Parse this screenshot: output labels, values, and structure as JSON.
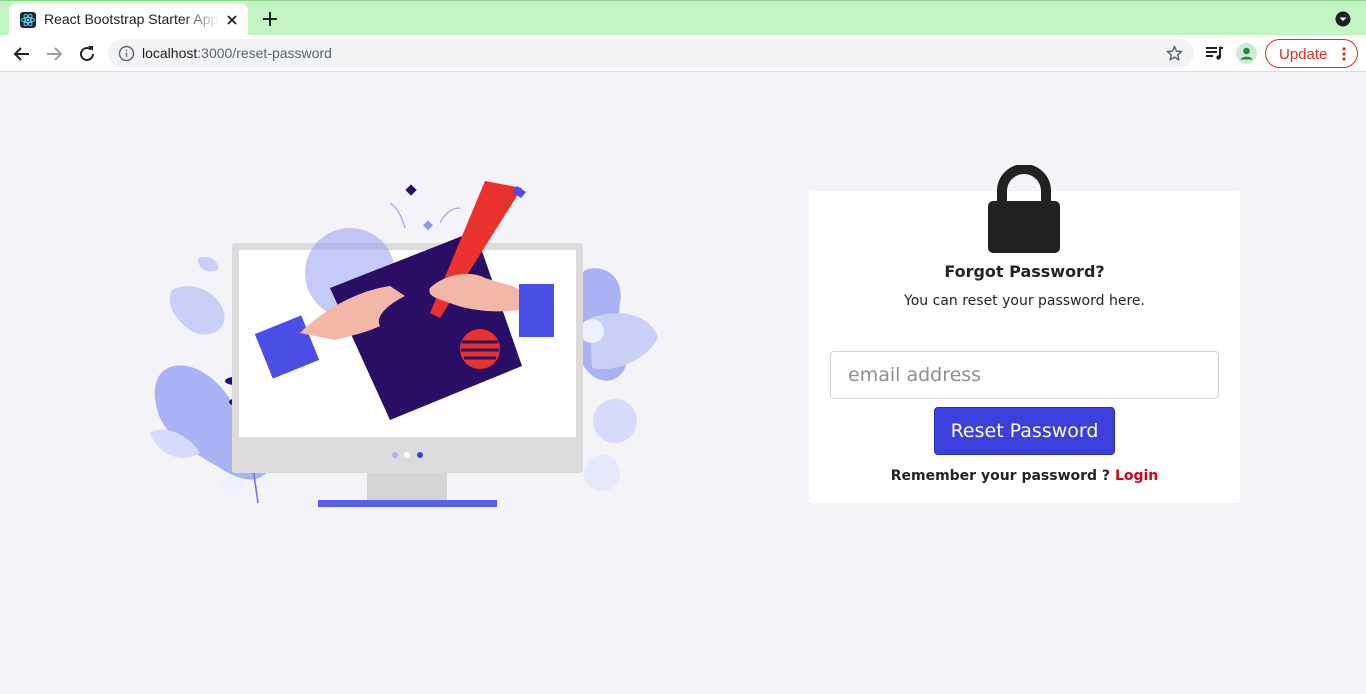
{
  "browser": {
    "tab_title": "React Bootstrap Starter App",
    "url_host": "localhost",
    "url_rest": ":3000/reset-password",
    "update_label": "Update"
  },
  "reset": {
    "title": "Forgot Password?",
    "subtitle": "You can reset your password here.",
    "email_placeholder": "email address",
    "submit_label": "Reset Password",
    "remember_text": "Remember your password ?",
    "login_label": "Login"
  },
  "colors": {
    "accent": "#3b3fdb",
    "link": "#d0021b",
    "page_bg": "#f4f3f8",
    "tabbar_bg": "#c3f5c3"
  }
}
